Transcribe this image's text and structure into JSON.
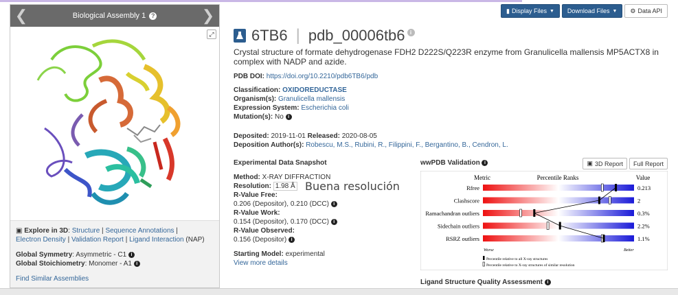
{
  "assembly": {
    "title": "Biological Assembly 1",
    "help": "?"
  },
  "explore": {
    "prefix": "Explore in 3D",
    "links": [
      "Structure",
      "Sequence Annotations",
      "Electron Density",
      "Validation Report",
      "Ligand Interaction"
    ],
    "suffix": "(NAP)"
  },
  "symmetry": {
    "label": "Global Symmetry",
    "value": "Asymmetric - C1"
  },
  "stoichiometry": {
    "label": "Global Stoichiometry",
    "value": "Monomer - A1"
  },
  "find_similar": "Find Similar Assemblies",
  "buttons": {
    "display_files": "Display Files",
    "download_files": "Download Files",
    "data_api": "Data API"
  },
  "entry": {
    "id": "6TB6",
    "pdb_id": "pdb_00006tb6"
  },
  "description": "Crystal structure of formate dehydrogenase FDH2 D222S/Q223R enzyme from Granulicella mallensis MP5ACTX8 in complex with NADP and azide.",
  "doi": {
    "label": "PDB DOI:",
    "value": "https://doi.org/10.2210/pdb6TB6/pdb"
  },
  "classification": {
    "label": "Classification:",
    "value": "OXIDOREDUCTASE"
  },
  "organism": {
    "label": "Organism(s):",
    "value": "Granulicella mallensis"
  },
  "expression": {
    "label": "Expression System:",
    "value": "Escherichia coli"
  },
  "mutation": {
    "label": "Mutation(s):",
    "value": "No"
  },
  "deposited": {
    "label": "Deposited:",
    "value": "2019-11-01"
  },
  "released": {
    "label": "Released:",
    "value": "2020-08-05"
  },
  "authors": {
    "label": "Deposition Author(s):",
    "value": "Robescu, M.S., Rubini, R., Filippini, F., Bergantino, B., Cendron, L."
  },
  "snapshot": {
    "heading": "Experimental Data Snapshot",
    "method_label": "Method:",
    "method": "X-RAY DIFFRACTION",
    "resolution_label": "Resolution:",
    "resolution": "1.98 Å",
    "rfree_label": "R-Value Free:",
    "rfree": "0.206 (Depositor), 0.210 (DCC)",
    "rwork_label": "R-Value Work:",
    "rwork": "0.154 (Depositor), 0.170 (DCC)",
    "robs_label": "R-Value Observed:",
    "robs": "0.156 (Depositor)",
    "model_label": "Starting Model:",
    "model": "experimental",
    "more": "View more details"
  },
  "annotation": "Buena resolución",
  "validation": {
    "title": "wwPDB Validation",
    "btn_3d": "3D Report",
    "btn_full": "Full Report",
    "header_metric": "Metric",
    "header_ranks": "Percentile Ranks",
    "header_value": "Value",
    "worse": "Worse",
    "better": "Better",
    "legend_all": "Percentile relative to all X-ray structures",
    "legend_similar": "Percentile relative to X-ray structures of similar resolution",
    "metrics": [
      {
        "name": "Rfree",
        "value": "0.213",
        "pct_all": 0.88,
        "pct_similar": 0.79
      },
      {
        "name": "Clashscore",
        "value": "2",
        "pct_all": 0.77,
        "pct_similar": 0.84
      },
      {
        "name": "Ramachandran outliers",
        "value": "0.3%",
        "pct_all": 0.34,
        "pct_similar": 0.25
      },
      {
        "name": "Sidechain outliers",
        "value": "2.2%",
        "pct_all": 0.51,
        "pct_similar": 0.43
      },
      {
        "name": "RSRZ outliers",
        "value": "1.1%",
        "pct_all": 0.8,
        "pct_similar": 0.79
      }
    ]
  },
  "ligand": "Ligand Structure Quality Assessment"
}
